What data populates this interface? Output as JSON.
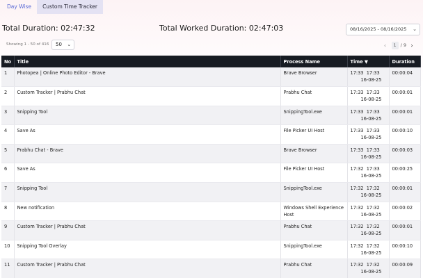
{
  "tabs": [
    {
      "label": "Day Wise",
      "active": false
    },
    {
      "label": "Custom Time Tracker",
      "active": true
    }
  ],
  "summary": {
    "total_duration": "Total Duration: 02:47:32",
    "worked_duration": "Total Worked Duration: 02:47:03",
    "date_range": "08/16/2025 - 08/16/2025"
  },
  "listing": {
    "showing": "Showing 1 - 50 of 416",
    "per_page": "50"
  },
  "pagination": {
    "current": "1",
    "separator": "/",
    "total": "9"
  },
  "table": {
    "headers": [
      "No",
      "Title",
      "Process Name",
      "Time ▼",
      "Duration"
    ],
    "rows": [
      {
        "no": "1",
        "title": "Photopea | Online Photo Editor - Brave",
        "process": "Brave Browser",
        "start": "17:33",
        "end": "17:33",
        "date": "16-08-25",
        "duration": "00:00:04"
      },
      {
        "no": "2",
        "title": "Custom Tracker | Prabhu Chat",
        "process": "Prabhu Chat",
        "start": "17:33",
        "end": "17:33",
        "date": "16-08-25",
        "duration": "00:00:01"
      },
      {
        "no": "3",
        "title": "Snipping Tool",
        "process": "SnippingTool.exe",
        "start": "17:33",
        "end": "17:33",
        "date": "16-08-25",
        "duration": "00:00:01"
      },
      {
        "no": "4",
        "title": "Save As",
        "process": "File Picker UI Host",
        "start": "17:33",
        "end": "17:33",
        "date": "16-08-25",
        "duration": "00:00:10"
      },
      {
        "no": "5",
        "title": "Prabhu Chat - Brave",
        "process": "Brave Browser",
        "start": "17:33",
        "end": "17:33",
        "date": "16-08-25",
        "duration": "00:00:03"
      },
      {
        "no": "6",
        "title": "Save As",
        "process": "File Picker UI Host",
        "start": "17:32",
        "end": "17:33",
        "date": "16-08-25",
        "duration": "00:00:25"
      },
      {
        "no": "7",
        "title": "Snipping Tool",
        "process": "SnippingTool.exe",
        "start": "17:32",
        "end": "17:32",
        "date": "16-08-25",
        "duration": "00:00:01"
      },
      {
        "no": "8",
        "title": "New notification",
        "process": "Windows Shell Experience Host",
        "start": "17:32",
        "end": "17:32",
        "date": "16-08-25",
        "duration": "00:00:02"
      },
      {
        "no": "9",
        "title": "Custom Tracker | Prabhu Chat",
        "process": "Prabhu Chat",
        "start": "17:32",
        "end": "17:32",
        "date": "16-08-25",
        "duration": "00:00:01"
      },
      {
        "no": "10",
        "title": "Snipping Tool Overlay",
        "process": "SnippingTool.exe",
        "start": "17:32",
        "end": "17:32",
        "date": "16-08-25",
        "duration": "00:00:10"
      },
      {
        "no": "11",
        "title": "Custom Tracker | Prabhu Chat",
        "process": "Prabhu Chat",
        "start": "17:32",
        "end": "17:32",
        "date": "16-08-25",
        "duration": "00:00:09"
      }
    ]
  },
  "icons": {
    "date_chevron": "chevron-down-icon",
    "per_page_chevron": "chevron-down-icon",
    "prev": "chevron-left-icon",
    "next": "chevron-right-icon"
  }
}
